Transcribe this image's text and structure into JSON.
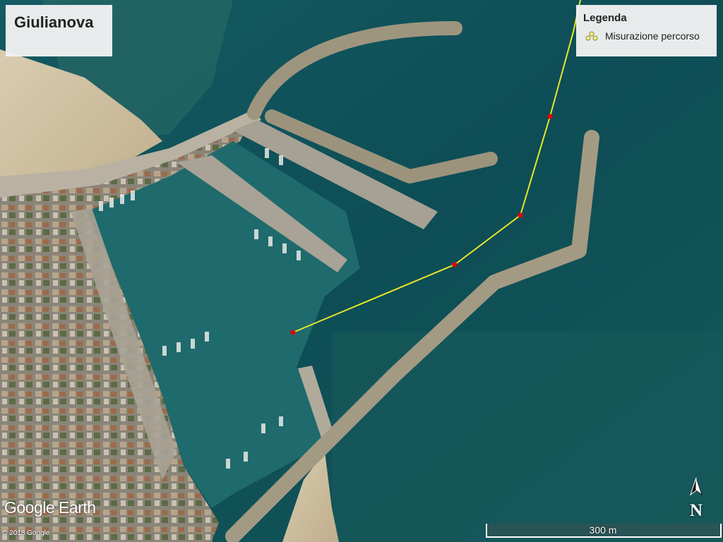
{
  "map": {
    "place_title": "Giulianova",
    "legend": {
      "title": "Legenda",
      "items": [
        {
          "label": "Misurazione percorso",
          "icon": "path-measurement-icon",
          "color": "#e6dc2a"
        }
      ]
    },
    "scale_label": "300 m",
    "north_label": "N",
    "brand": "Google Earth",
    "copyright": "© 2018 Google",
    "colors": {
      "water_inner": "#1f6a6c",
      "water_outer": "#0f4f57",
      "route": "#e9e628",
      "waypoint": "#e60000"
    }
  }
}
